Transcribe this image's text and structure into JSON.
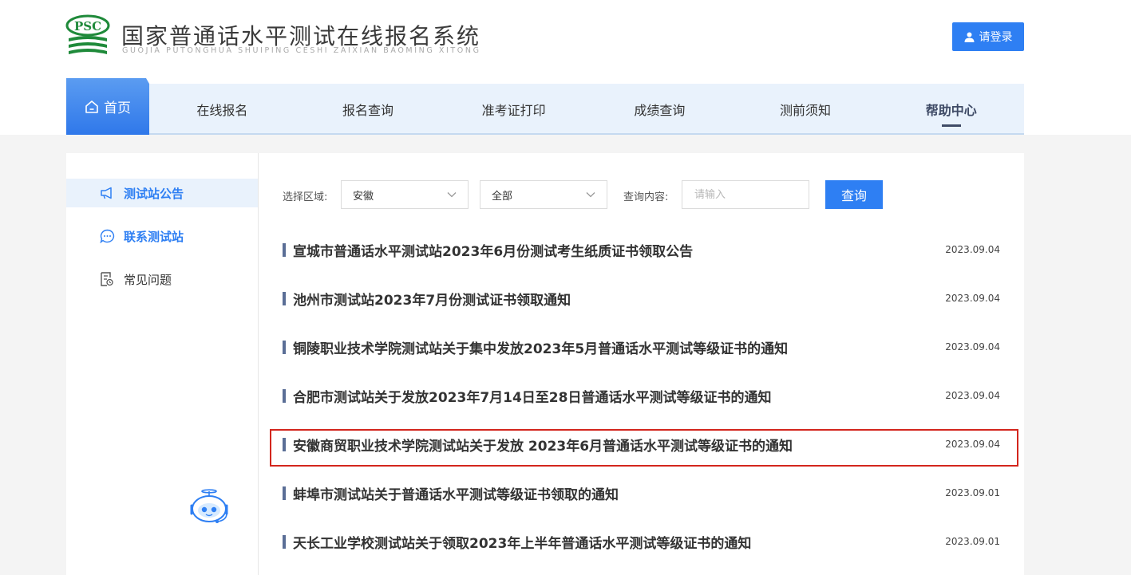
{
  "header": {
    "logo_text": "PSC",
    "title": "国家普通话水平测试在线报名系统",
    "subtitle": "GUOJIA PUTONGHUA SHUIPING CESHI ZAIXIAN BAOMING XITONG",
    "login_label": "请登录"
  },
  "nav": {
    "home": "首页",
    "items": [
      "在线报名",
      "报名查询",
      "准考证打印",
      "成绩查询",
      "测前须知",
      "帮助中心"
    ],
    "active_index": 5
  },
  "sidebar": {
    "items": [
      {
        "label": "测试站公告",
        "icon": "megaphone-icon"
      },
      {
        "label": "联系测试站",
        "icon": "chat-bubble-icon"
      },
      {
        "label": "常见问题",
        "icon": "document-icon"
      }
    ]
  },
  "filter": {
    "region_label": "选择区域:",
    "region_value": "安徽",
    "scope_value": "全部",
    "query_label": "查询内容:",
    "query_placeholder": "请输入",
    "query_button": "查询"
  },
  "notices": [
    {
      "title": "宣城市普通话水平测试站2023年6月份测试考生纸质证书领取公告",
      "date": "2023.09.04"
    },
    {
      "title": "池州市测试站2023年7月份测试证书领取通知",
      "date": "2023.09.04"
    },
    {
      "title": "铜陵职业技术学院测试站关于集中发放2023年5月普通话水平测试等级证书的通知",
      "date": "2023.09.04"
    },
    {
      "title": "合肥市测试站关于发放2023年7月14日至28日普通话水平测试等级证书的通知",
      "date": "2023.09.04"
    },
    {
      "title": "安徽商贸职业技术学院测试站关于发放 2023年6月普通话水平测试等级证书的通知",
      "date": "2023.09.04",
      "highlighted": true
    },
    {
      "title": "蚌埠市测试站关于普通话水平测试等级证书领取的通知",
      "date": "2023.09.01"
    },
    {
      "title": "天长工业学校测试站关于领取2023年上半年普通话水平测试等级证书的通知",
      "date": "2023.09.01"
    }
  ],
  "colors": {
    "accent": "#2e7ff3",
    "nav_bg": "#e9f2fc",
    "logo_green": "#1f8a3a",
    "highlight_border": "#d3261d"
  }
}
